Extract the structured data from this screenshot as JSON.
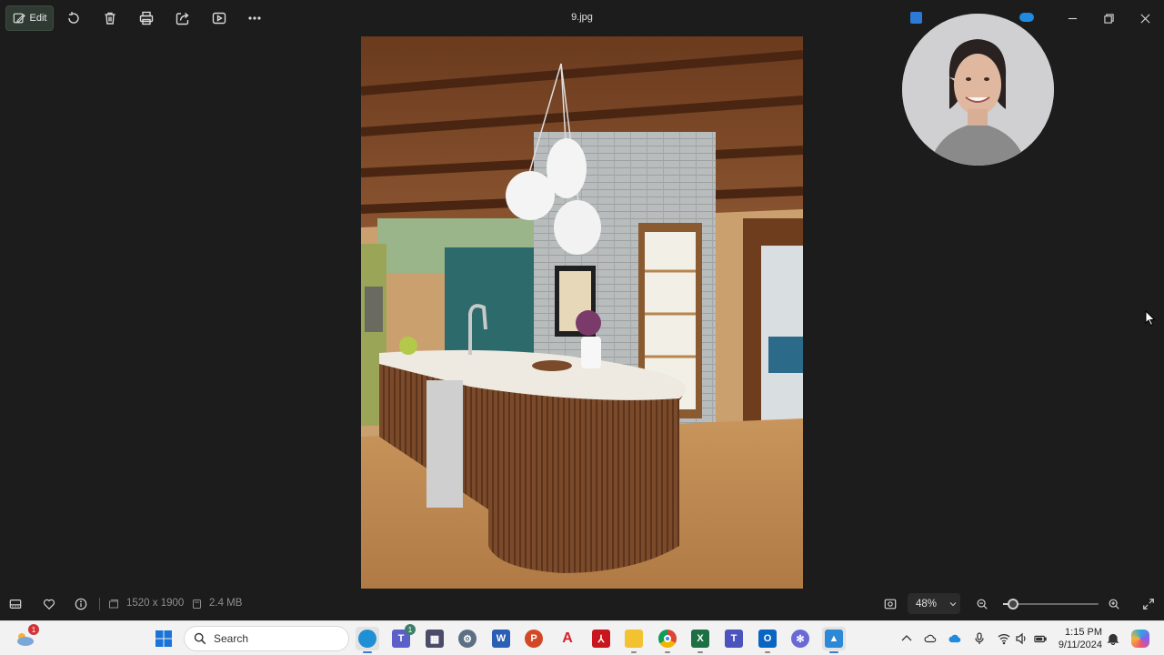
{
  "window": {
    "title": "9.jpg",
    "edit_label": "Edit"
  },
  "toolbar": {
    "icons": [
      "rotate-icon",
      "delete-icon",
      "print-icon",
      "share-icon",
      "slideshow-icon",
      "more-icon"
    ],
    "more_label": "···"
  },
  "photo": {
    "subject": "kitchen-interior-photo"
  },
  "statusbar": {
    "dimensions": "1520 x 1900",
    "filesize": "2.4 MB",
    "zoom_label": "48%",
    "zoom_fraction": 0.1
  },
  "taskbar": {
    "search_placeholder": "Search",
    "weather_badge": "1",
    "teams_badge": "1",
    "time": "1:15 PM",
    "date": "9/11/2024"
  },
  "colors": {
    "accent": "#3a8a5a",
    "background": "#1c1c1c",
    "taskbar": "#f2f2f2"
  }
}
